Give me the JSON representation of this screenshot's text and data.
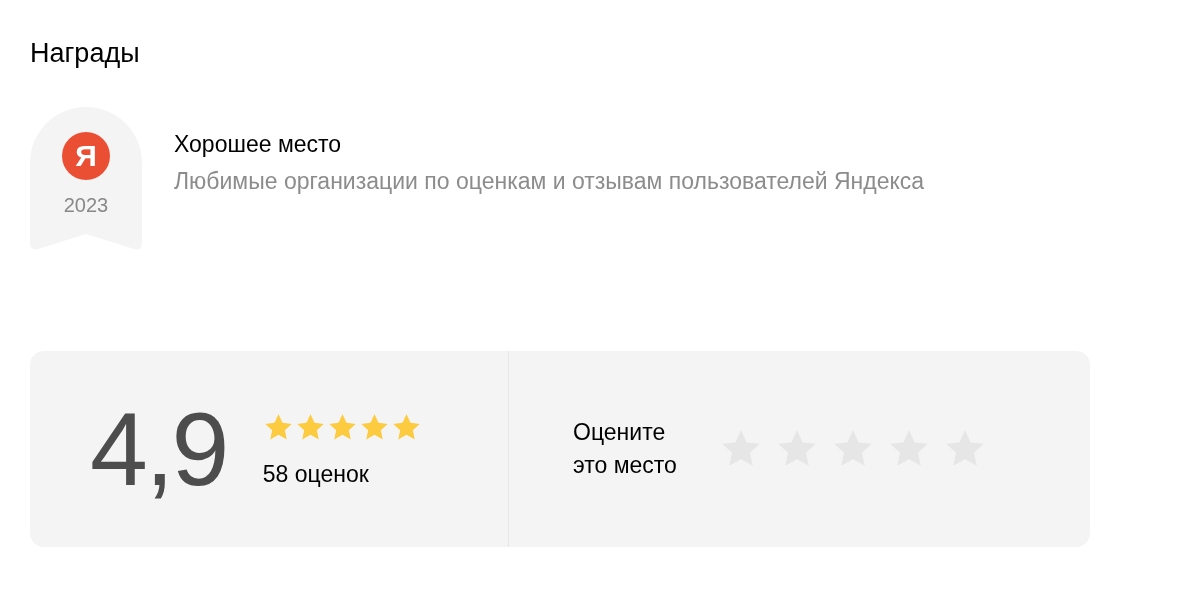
{
  "section_title": "Награды",
  "awards": [
    {
      "logo_letter": "Я",
      "year": "2023",
      "title": "Хорошее место",
      "description": "Любимые организации по оценкам и отзывам пользователей Яндекса"
    }
  ],
  "rating": {
    "value": "4,9",
    "stars": 5,
    "count": "58 оценок"
  },
  "rate_prompt": {
    "label": "Оцените\nэто место"
  }
}
